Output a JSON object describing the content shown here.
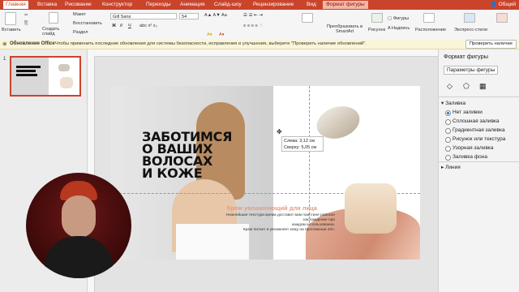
{
  "tabs": [
    "Главная",
    "Вставка",
    "Рисование",
    "Конструктор",
    "Переходы",
    "Анимация",
    "Слайд-шоу",
    "Рецензирование",
    "Вид",
    "Формат фигуры"
  ],
  "share_label": "Общий",
  "ribbon": {
    "paste": "Вставить",
    "layout": "Макет",
    "create_slide": "Создать слайд",
    "reset": "Восстановить",
    "section": "Раздел",
    "font_name": "Gill Sans",
    "font_size": "54",
    "convert_smartart": "Преобразовать в SmartArt",
    "picture": "Рисунок",
    "shapes": "Фигуры",
    "textbox": "Надпись",
    "arrange": "Расположение",
    "quick_styles": "Экспресс-стили"
  },
  "notice": {
    "title": "Обновление Office",
    "text": "Чтобы применить последние обновления для системы безопасности, исправления и улучшения, выберите \"Проверить наличие обновлений\".",
    "button": "Проверить наличие"
  },
  "slide_number": "1",
  "slide": {
    "headline_lines": [
      "ЗАБОТИМСЯ",
      "О ВАШИХ",
      "ВОЛОСАХ",
      "И КОЖЕ"
    ],
    "subhead": "Крем увлажняющий для лица",
    "body_lines": [
      "Нежнейшая текстура крема доставит вам поистине райское наслаждение при",
      "каждом использовании.",
      "Крем питает и увлажняет кожу на протяжении 24ч."
    ]
  },
  "tooltip": {
    "line1": "Слева: 3,12 см",
    "line2": "Сверху: 5,05 см"
  },
  "pane": {
    "title": "Формат фигуры",
    "tab": "Параметры фигуры",
    "fill_section": "Заливка",
    "fill_options": [
      "Нет заливки",
      "Сплошная заливка",
      "Градиентная заливка",
      "Рисунок или текстура",
      "Узорная заливка",
      "Заливка фона"
    ],
    "selected_fill": "Нет заливки",
    "line_section": "Линия"
  },
  "colors": {
    "accent": "#c9442b",
    "subhead": "#e79a80",
    "selection": "#1f6fd6"
  }
}
